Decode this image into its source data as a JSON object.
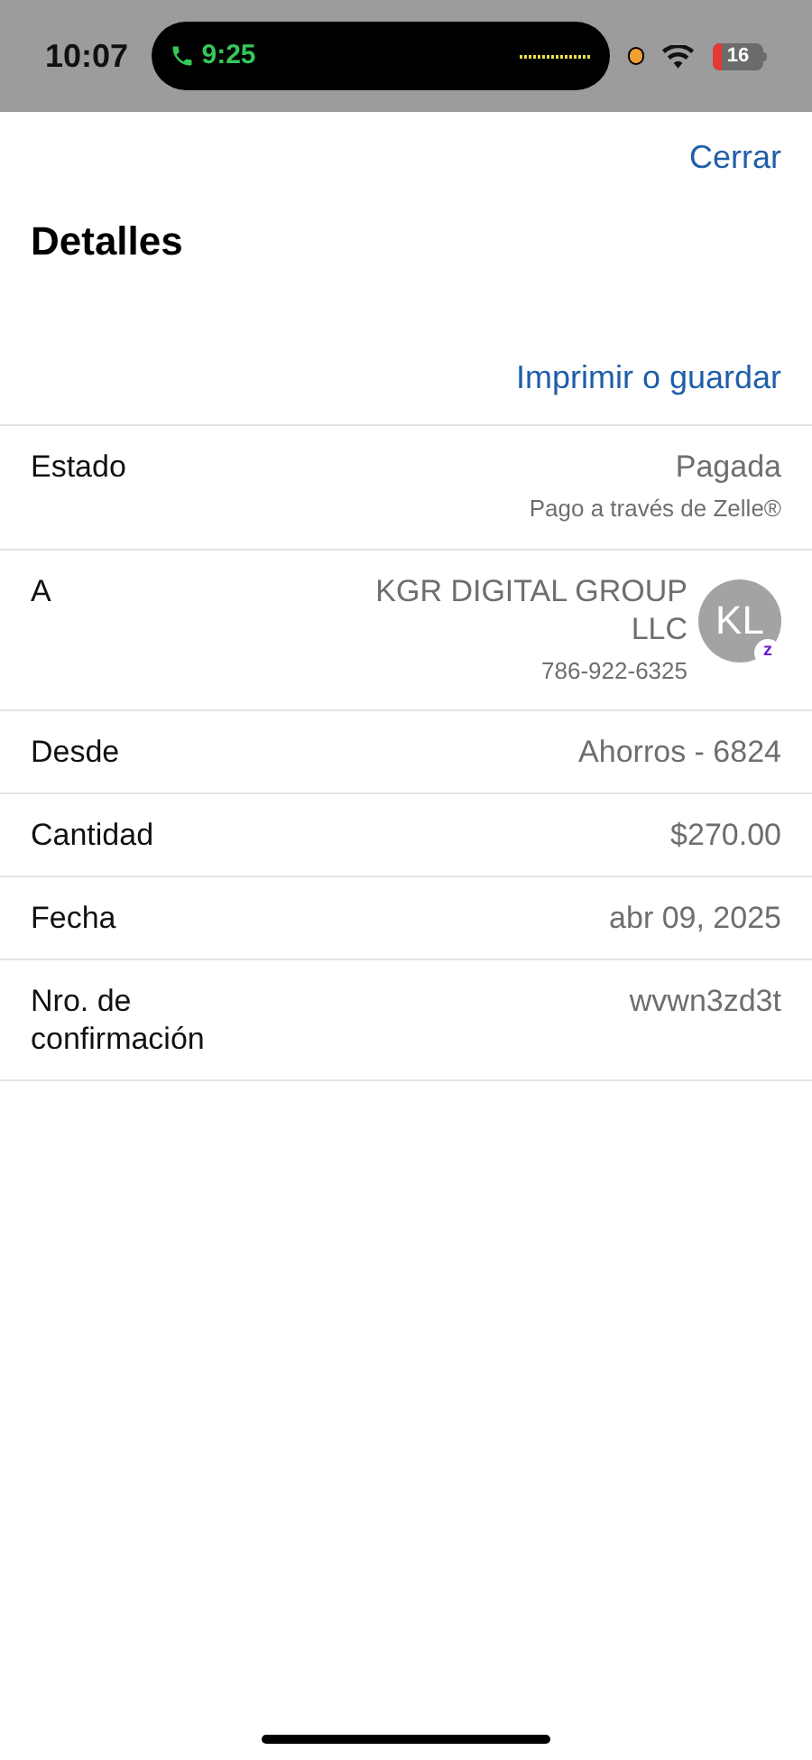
{
  "status_bar": {
    "time": "10:07",
    "call_time": "9:25",
    "battery": "16"
  },
  "header": {
    "close": "Cerrar",
    "title": "Detalles",
    "print": "Imprimir o guardar"
  },
  "rows": [
    {
      "kind": "text",
      "label": "Estado",
      "value": "Pagada",
      "subtext": "Pago a través de Zelle®"
    },
    {
      "kind": "contact",
      "label": "A",
      "value": "KGR DIGITAL GROUP LLC",
      "subtext": "786-922-6325",
      "avatar": {
        "initials": "KL",
        "badge": "z"
      }
    },
    {
      "kind": "text",
      "label": "Desde",
      "value": "Ahorros - 6824"
    },
    {
      "kind": "text",
      "label": "Cantidad",
      "value": "$270.00"
    },
    {
      "kind": "text",
      "label": "Fecha",
      "value": "abr 09, 2025"
    },
    {
      "kind": "text",
      "label": "Nro. de confirmación",
      "value": "wvwn3zd3t"
    }
  ]
}
